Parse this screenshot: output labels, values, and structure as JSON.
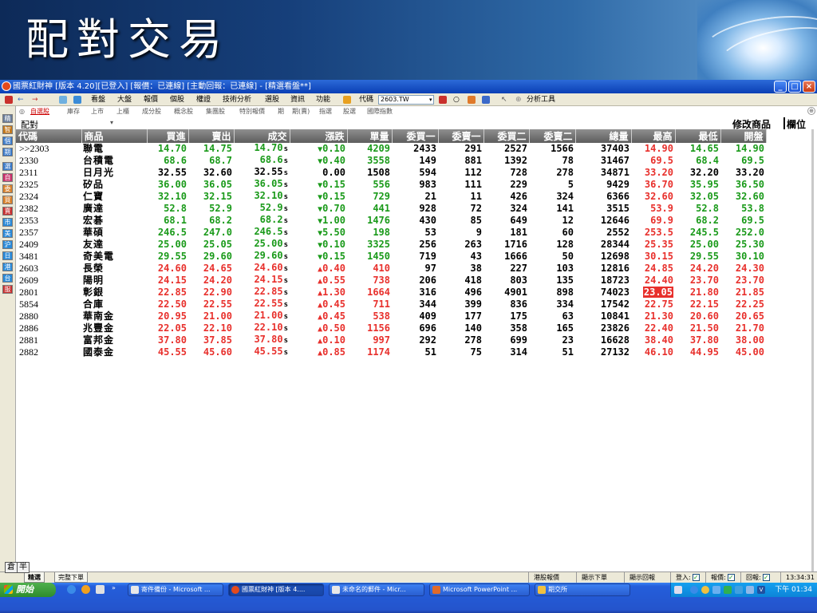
{
  "slide": {
    "title": "配對交易"
  },
  "window": {
    "title": "國票紅財神 [版本 4.20][已登入] [報價：已連線] [主動回報：已連線] - [精選看盤**]"
  },
  "toolbar": {
    "items": [
      "看盤",
      "大盤",
      "報價",
      "個股",
      "權證",
      "技術分析",
      "選股",
      "資訊",
      "功能"
    ],
    "code_label": "代碼",
    "code_value": "2603.TW",
    "analysis_tool": "分析工具"
  },
  "left_strip": {
    "buttons": [
      "精",
      "智",
      "個",
      "期",
      "選",
      "自",
      "委",
      "買",
      "賣",
      "市",
      "美",
      "沪",
      "日",
      "港",
      "台",
      "服"
    ],
    "stack": "倉"
  },
  "tabs": [
    "自選股",
    "庫存",
    "上市",
    "上櫃",
    "成分股",
    "概念股",
    "集團股",
    "特別報價",
    "期",
    "期(賣)",
    "指選",
    "股選",
    "國際指數"
  ],
  "group": {
    "name": "配對",
    "modify_label": "修改商品",
    "columns_label": "欄位"
  },
  "quote_table": {
    "headers": [
      "代碼",
      "商品",
      "買進",
      "賣出",
      "成交",
      "漲跌",
      "單量",
      "委買一",
      "委賣一",
      "委買二",
      "委賣二",
      "總量",
      "最高",
      "最低",
      "開盤"
    ],
    "rows": [
      {
        "code": ">>2303",
        "name": "聯電",
        "bid": "14.70",
        "ask": "14.75",
        "last": "14.70",
        "trend": "down",
        "change": "0.10",
        "vol": "4209",
        "b1": "2433",
        "s1": "291",
        "b2": "2527",
        "s2": "1566",
        "total": "37403",
        "high": "14.90",
        "low": "14.65",
        "open": "14.90"
      },
      {
        "code": "2330",
        "name": "台積電",
        "bid": "68.6",
        "ask": "68.7",
        "last": "68.6",
        "trend": "down",
        "change": "0.40",
        "vol": "3558",
        "b1": "149",
        "s1": "881",
        "b2": "1392",
        "s2": "78",
        "total": "31467",
        "high": "69.5",
        "low": "68.4",
        "open": "69.5"
      },
      {
        "code": "2311",
        "name": "日月光",
        "bid": "32.55",
        "ask": "32.60",
        "last": "32.55",
        "trend": "flat",
        "change": "0.00",
        "vol": "1508",
        "b1": "594",
        "s1": "112",
        "b2": "728",
        "s2": "278",
        "total": "34871",
        "high": "33.20",
        "low": "32.20",
        "open": "33.20"
      },
      {
        "code": "2325",
        "name": "矽品",
        "bid": "36.00",
        "ask": "36.05",
        "last": "36.05",
        "trend": "down",
        "change": "0.15",
        "vol": "556",
        "b1": "983",
        "s1": "111",
        "b2": "229",
        "s2": "5",
        "total": "9429",
        "high": "36.70",
        "low": "35.95",
        "open": "36.50"
      },
      {
        "code": "2324",
        "name": "仁寶",
        "bid": "32.10",
        "ask": "32.15",
        "last": "32.10",
        "trend": "down",
        "change": "0.15",
        "vol": "729",
        "b1": "21",
        "s1": "11",
        "b2": "426",
        "s2": "324",
        "total": "6366",
        "high": "32.60",
        "low": "32.05",
        "open": "32.60"
      },
      {
        "code": "2382",
        "name": "廣達",
        "bid": "52.8",
        "ask": "52.9",
        "last": "52.9",
        "trend": "down",
        "change": "0.70",
        "vol": "441",
        "b1": "928",
        "s1": "72",
        "b2": "324",
        "s2": "141",
        "total": "3515",
        "high": "53.9",
        "low": "52.8",
        "open": "53.8"
      },
      {
        "code": "2353",
        "name": "宏碁",
        "bid": "68.1",
        "ask": "68.2",
        "last": "68.2",
        "trend": "down",
        "change": "1.00",
        "vol": "1476",
        "b1": "430",
        "s1": "85",
        "b2": "649",
        "s2": "12",
        "total": "12646",
        "high": "69.9",
        "low": "68.2",
        "open": "69.5"
      },
      {
        "code": "2357",
        "name": "華碩",
        "bid": "246.5",
        "ask": "247.0",
        "last": "246.5",
        "trend": "down",
        "change": "5.50",
        "vol": "198",
        "b1": "53",
        "s1": "9",
        "b2": "181",
        "s2": "60",
        "total": "2552",
        "high": "253.5",
        "low": "245.5",
        "open": "252.0"
      },
      {
        "code": "2409",
        "name": "友達",
        "bid": "25.00",
        "ask": "25.05",
        "last": "25.00",
        "trend": "down",
        "change": "0.10",
        "vol": "3325",
        "b1": "256",
        "s1": "263",
        "b2": "1716",
        "s2": "128",
        "total": "28344",
        "high": "25.35",
        "low": "25.00",
        "open": "25.30"
      },
      {
        "code": "3481",
        "name": "奇美電",
        "bid": "29.55",
        "ask": "29.60",
        "last": "29.60",
        "trend": "down",
        "change": "0.15",
        "vol": "1450",
        "b1": "719",
        "s1": "43",
        "b2": "1666",
        "s2": "50",
        "total": "12698",
        "high": "30.15",
        "low": "29.55",
        "open": "30.10"
      },
      {
        "code": "2603",
        "name": "長榮",
        "bid": "24.60",
        "ask": "24.65",
        "last": "24.60",
        "trend": "up",
        "change": "0.40",
        "vol": "410",
        "b1": "97",
        "s1": "38",
        "b2": "227",
        "s2": "103",
        "total": "12816",
        "high": "24.85",
        "low": "24.20",
        "open": "24.30"
      },
      {
        "code": "2609",
        "name": "陽明",
        "bid": "24.15",
        "ask": "24.20",
        "last": "24.15",
        "trend": "up",
        "change": "0.55",
        "vol": "738",
        "b1": "206",
        "s1": "418",
        "b2": "803",
        "s2": "135",
        "total": "18723",
        "high": "24.40",
        "low": "23.70",
        "open": "23.70"
      },
      {
        "code": "2801",
        "name": "彰銀",
        "bid": "22.85",
        "ask": "22.90",
        "last": "22.85",
        "trend": "up",
        "change": "1.30",
        "vol": "1664",
        "b1": "316",
        "s1": "496",
        "b2": "4901",
        "s2": "898",
        "total": "74023",
        "high": "23.05",
        "low": "21.80",
        "open": "21.85",
        "high_flag": true
      },
      {
        "code": "5854",
        "name": "合庫",
        "bid": "22.50",
        "ask": "22.55",
        "last": "22.55",
        "trend": "up",
        "change": "0.45",
        "vol": "711",
        "b1": "344",
        "s1": "399",
        "b2": "836",
        "s2": "334",
        "total": "17542",
        "high": "22.75",
        "low": "22.15",
        "open": "22.25"
      },
      {
        "code": "2880",
        "name": "華南金",
        "bid": "20.95",
        "ask": "21.00",
        "last": "21.00",
        "trend": "up",
        "change": "0.45",
        "vol": "538",
        "b1": "409",
        "s1": "177",
        "b2": "175",
        "s2": "63",
        "total": "10841",
        "high": "21.30",
        "low": "20.60",
        "open": "20.65"
      },
      {
        "code": "2886",
        "name": "兆豐金",
        "bid": "22.05",
        "ask": "22.10",
        "last": "22.10",
        "trend": "up",
        "change": "0.50",
        "vol": "1156",
        "b1": "696",
        "s1": "140",
        "b2": "358",
        "s2": "165",
        "total": "23826",
        "high": "22.40",
        "low": "21.50",
        "open": "21.70"
      },
      {
        "code": "2881",
        "name": "富邦金",
        "bid": "37.80",
        "ask": "37.85",
        "last": "37.80",
        "trend": "up",
        "change": "0.10",
        "vol": "997",
        "b1": "292",
        "s1": "278",
        "b2": "699",
        "s2": "23",
        "total": "16628",
        "high": "38.40",
        "low": "37.80",
        "open": "38.00"
      },
      {
        "code": "2882",
        "name": "國泰金",
        "bid": "45.55",
        "ask": "45.60",
        "last": "45.55",
        "trend": "up",
        "change": "0.85",
        "vol": "1174",
        "b1": "51",
        "s1": "75",
        "b2": "314",
        "s2": "51",
        "total": "27132",
        "high": "46.10",
        "low": "44.95",
        "open": "45.00"
      }
    ],
    "last_suffix": "s"
  },
  "ime": [
    "倉",
    "半"
  ],
  "statusbar": {
    "tabs": [
      "精選",
      "完整下單"
    ],
    "right": [
      "港股報價",
      "顯示下單",
      "顯示回報"
    ],
    "login_label": "登入:",
    "quote_label": "報價:",
    "report_label": "回報:",
    "time": "13:34:31"
  },
  "taskbar": {
    "start": "開始",
    "tasks": [
      "寄件備份 - Microsoft ...",
      "國票紅財神 [版本 4....",
      "未命名的郵件 - Micr...",
      "Microsoft PowerPoint ...",
      "期交所"
    ],
    "clock": "下午 01:34"
  },
  "colors": {
    "up": "#e8302c",
    "down": "#1a9a1a",
    "flat": "#000000"
  }
}
